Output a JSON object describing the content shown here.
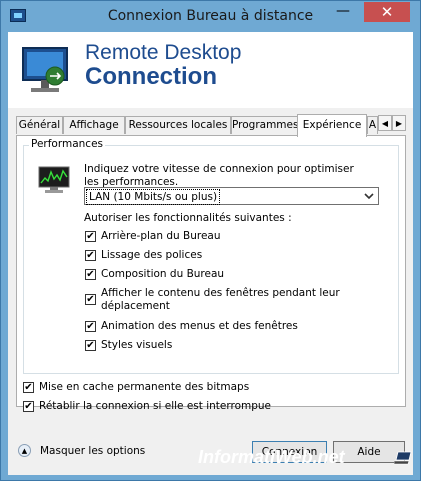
{
  "window": {
    "title": "Connexion Bureau à distance",
    "minimize_glyph": "—",
    "close_glyph": "✕"
  },
  "banner": {
    "line1": "Remote Desktop",
    "line2": "Connection"
  },
  "tabs": [
    {
      "label": "Général",
      "active": false
    },
    {
      "label": "Affichage",
      "active": false
    },
    {
      "label": "Ressources locales",
      "active": false
    },
    {
      "label": "Programmes",
      "active": false
    },
    {
      "label": "Expérience",
      "active": true
    },
    {
      "label": "A",
      "active": false
    }
  ],
  "tab_scroll": {
    "left_glyph": "◀",
    "right_glyph": "▶"
  },
  "performance": {
    "group_title": "Performances",
    "speed_prompt": "Indiquez votre vitesse de connexion pour optimiser les performances.",
    "speed_selected": "LAN (10 Mbits/s ou plus)",
    "features_prompt": "Autoriser les fonctionnalités suivantes :",
    "features": [
      {
        "label": "Arrière-plan du Bureau",
        "checked": true
      },
      {
        "label": "Lissage des polices",
        "checked": true
      },
      {
        "label": "Composition du Bureau",
        "checked": true
      },
      {
        "label": "Afficher le contenu des fenêtres pendant leur déplacement",
        "checked": true
      },
      {
        "label": "Animation des menus et des fenêtres",
        "checked": true
      },
      {
        "label": "Styles visuels",
        "checked": true
      }
    ]
  },
  "options": [
    {
      "label": "Mise en cache permanente des bitmaps",
      "checked": true
    },
    {
      "label": "Rétablir la connexion si elle est interrompue",
      "checked": true
    }
  ],
  "footer": {
    "toggle_label": "Masquer les options",
    "connect_label": "Connexion",
    "help_label": "Aide"
  },
  "watermark": {
    "text": "InformatiWeb.net"
  },
  "check_glyph": "✔",
  "colors": {
    "banner_text": "#1e4c8f",
    "window_frame": "#6fa9d3",
    "close_button": "#c75050"
  }
}
